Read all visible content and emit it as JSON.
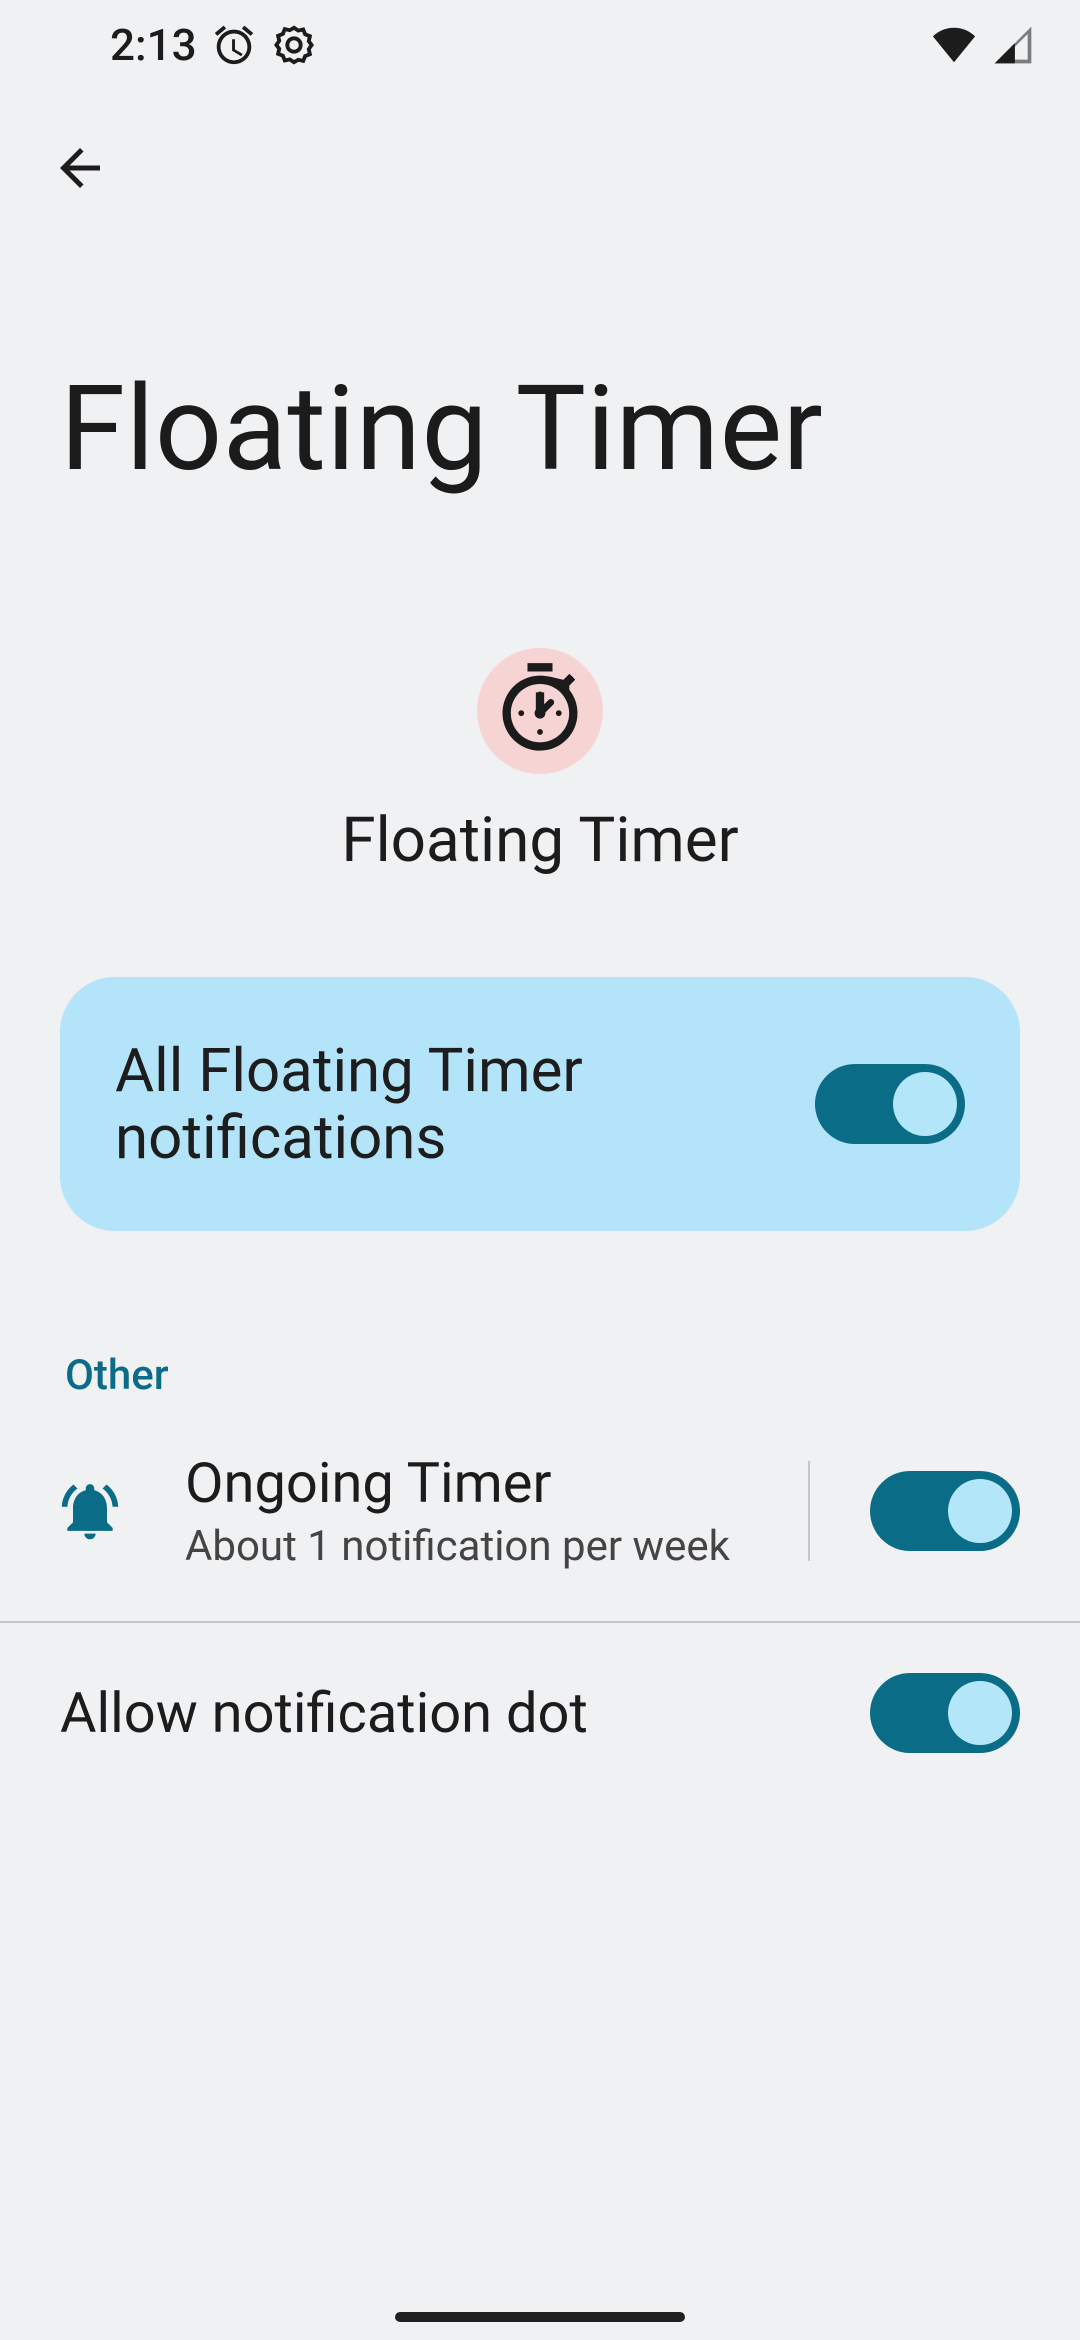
{
  "status": {
    "time": "2:13"
  },
  "page_title": "Floating Timer",
  "app": {
    "name": "Floating Timer"
  },
  "master": {
    "label": "All Floating Timer notifications",
    "enabled": true
  },
  "section": {
    "header": "Other"
  },
  "channel": {
    "title": "Ongoing Timer",
    "subtitle": "About 1 notification per week",
    "enabled": true
  },
  "dot": {
    "label": "Allow notification dot",
    "enabled": true
  },
  "colors": {
    "accent": "#0a6c87",
    "card": "#b3e4f9",
    "bg": "#f0f1f3",
    "app_icon_bg": "#f7d4d4"
  }
}
